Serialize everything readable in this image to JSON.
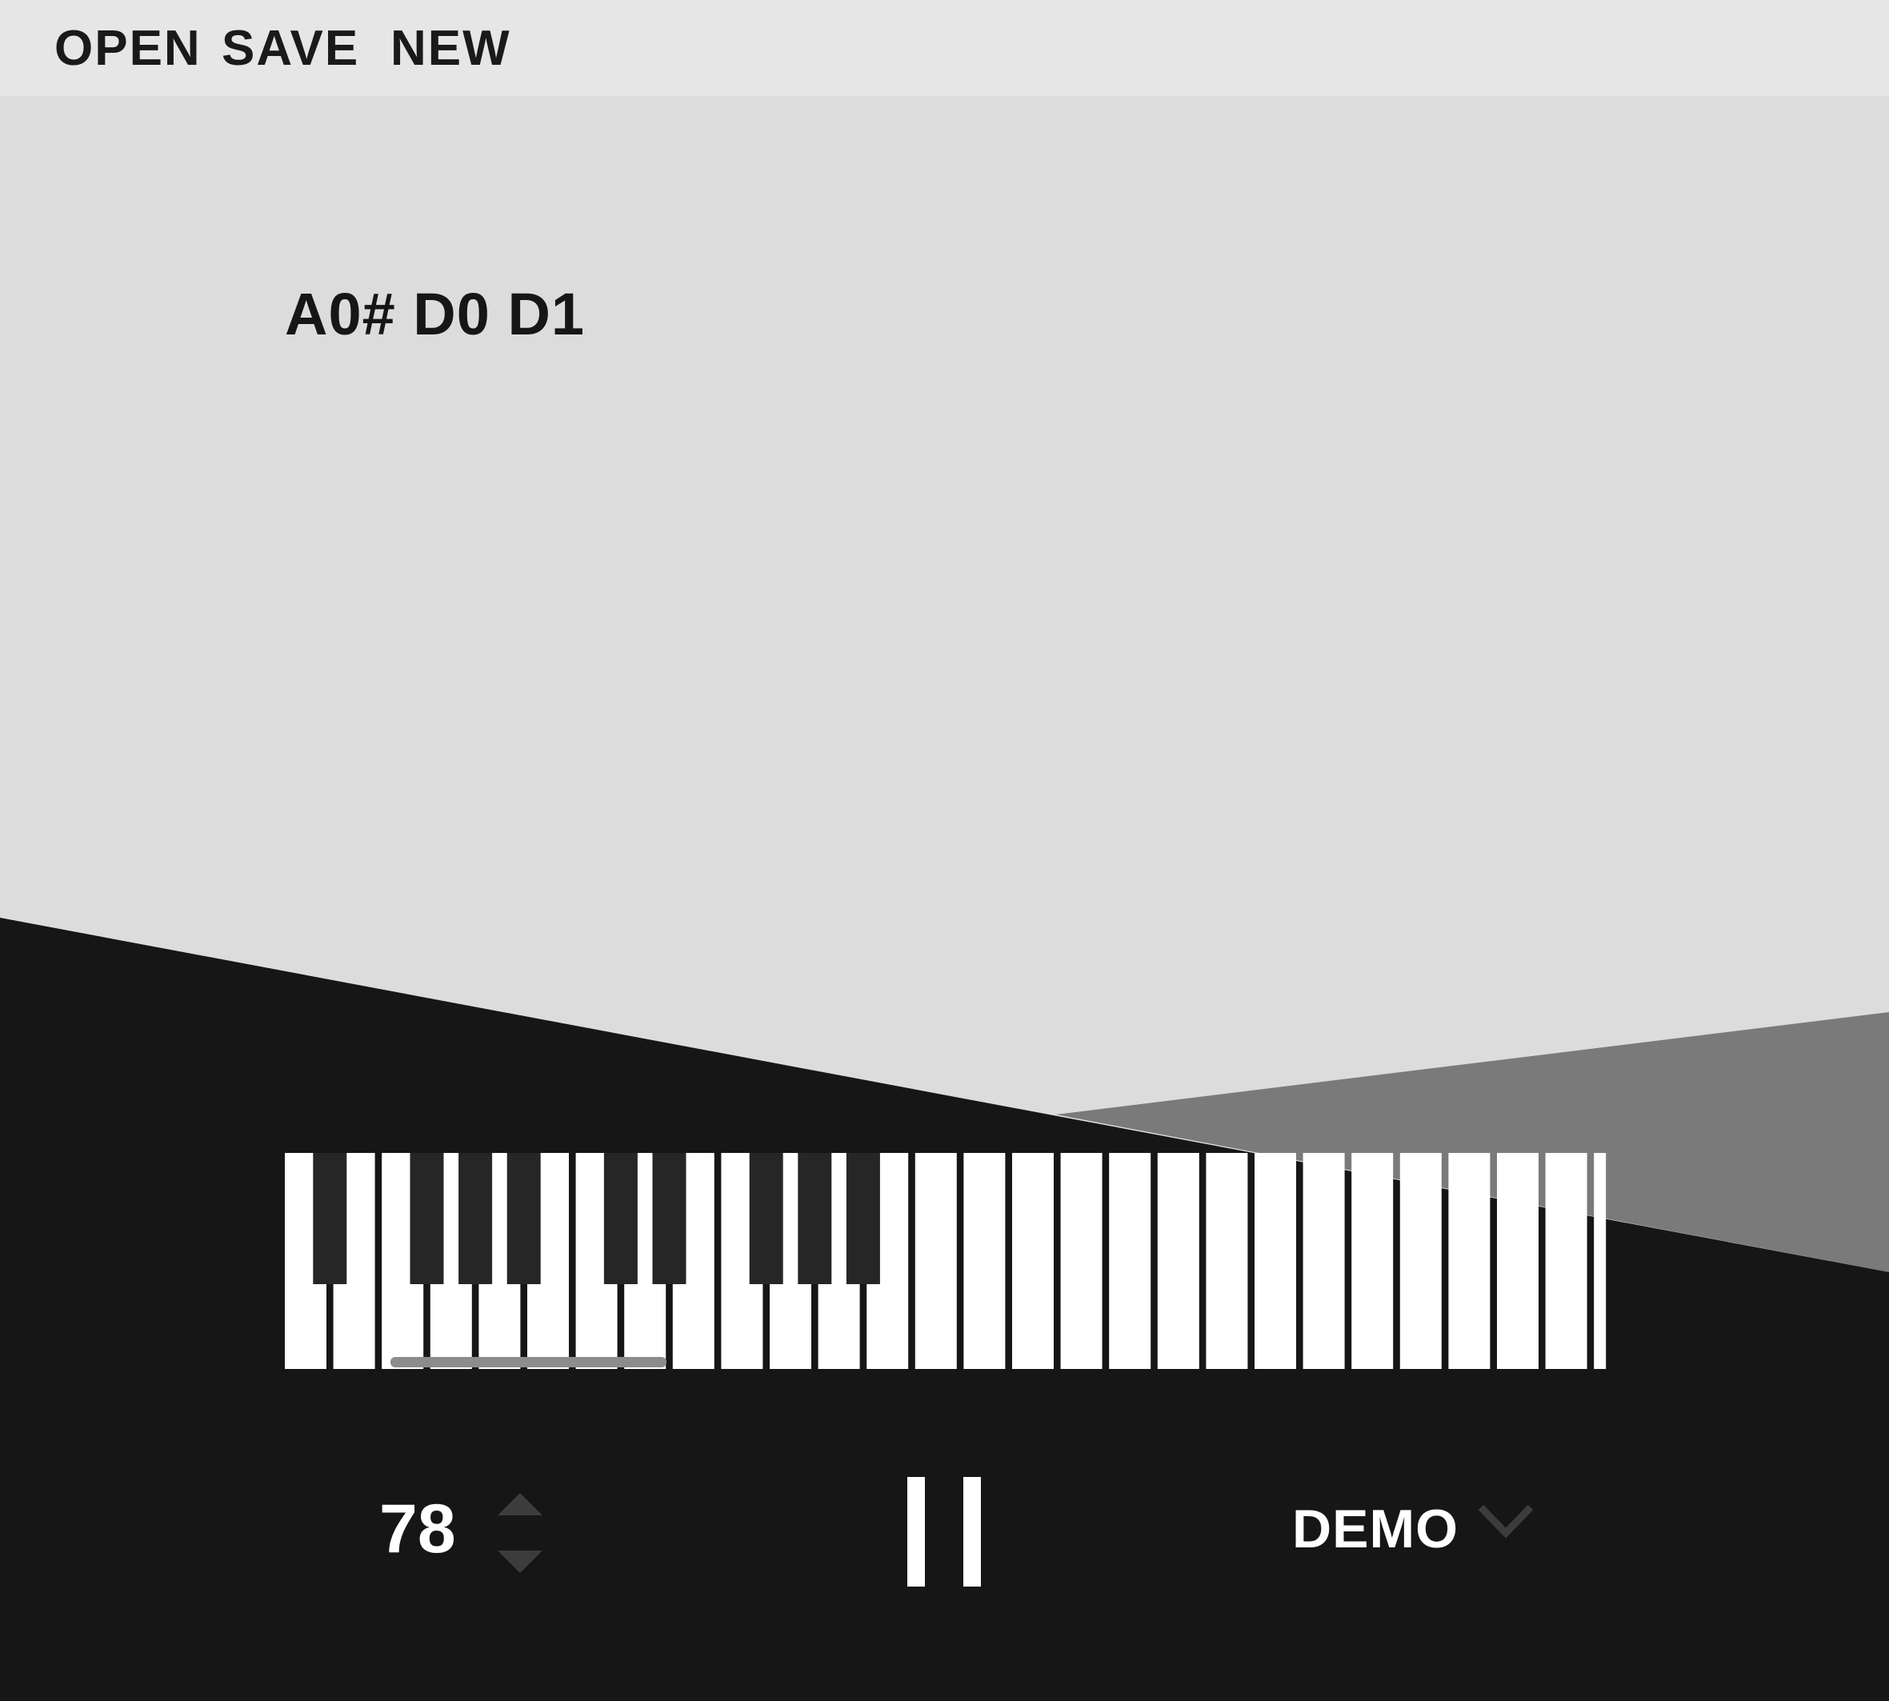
{
  "menu": {
    "open_label": "OPEN",
    "save_label": "SAVE",
    "new_label": "NEW"
  },
  "chord_display": "A0# D0 D1",
  "keyboard": {
    "white_key_count": 27,
    "black_key_groups": [
      [
        0
      ],
      [
        2,
        3,
        4
      ],
      [
        6,
        7
      ],
      [
        9,
        10,
        11
      ]
    ],
    "highlight_range": "held notes indicator"
  },
  "transport": {
    "tempo": "78",
    "song": "DEMO"
  },
  "colors": {
    "background": "#dcdcdc",
    "menu_bar": "#e6e6e6",
    "dark_panel": "#161616",
    "mid_panel": "#7a7a7a",
    "key_white": "#ffffff",
    "key_black": "#262626",
    "indicator": "#8c8c8c",
    "control_icon": "#3c3c3c"
  },
  "icons": {
    "tempo_up": "triangle-up-icon",
    "tempo_down": "triangle-down-icon",
    "pause": "pause-icon",
    "dropdown": "chevron-down-icon"
  }
}
